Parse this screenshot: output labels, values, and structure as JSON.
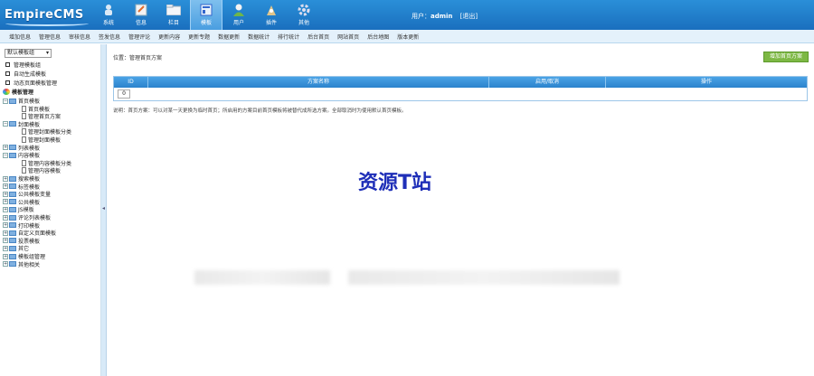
{
  "app": {
    "logo": "EmpireCMS"
  },
  "topnav": [
    {
      "label": "系统",
      "icon": "system-icon"
    },
    {
      "label": "信息",
      "icon": "info-icon"
    },
    {
      "label": "栏目",
      "icon": "column-icon"
    },
    {
      "label": "模板",
      "icon": "template-icon"
    },
    {
      "label": "用户",
      "icon": "user-icon"
    },
    {
      "label": "插件",
      "icon": "plugin-icon"
    },
    {
      "label": "其他",
      "icon": "other-icon"
    }
  ],
  "user": {
    "prefix": "用户：",
    "name": "admin",
    "logout": "[退出]"
  },
  "menubar": [
    "增加信息",
    "管理信息",
    "审核信息",
    "签发信息",
    "管理评论",
    "更新内容",
    "更新专题",
    "数据更新",
    "数据统计",
    "排行统计",
    "后台首页",
    "网站首页",
    "后台地图",
    "版本更新"
  ],
  "sidebar": {
    "select": "默认模板组",
    "links": [
      "管理模板组",
      "自动生成模板",
      "动态页面模板管理"
    ],
    "tree_root": "模板管理",
    "nodes": [
      {
        "label": "首页模板",
        "expanded": true,
        "children": [
          "首页模板",
          "管理首页方案"
        ]
      },
      {
        "label": "封面模板",
        "expanded": true,
        "children": [
          "管理封面模板分类",
          "管理封面模板"
        ]
      },
      {
        "label": "列表模板",
        "expanded": false,
        "children": []
      },
      {
        "label": "内容模板",
        "expanded": true,
        "children": [
          "管理内容模板分类",
          "管理内容模板"
        ]
      },
      {
        "label": "搜索模板",
        "expanded": false,
        "children": []
      },
      {
        "label": "标签模板",
        "expanded": false,
        "children": []
      },
      {
        "label": "公共模板变量",
        "expanded": false,
        "children": []
      },
      {
        "label": "公共模板",
        "expanded": false,
        "children": []
      },
      {
        "label": "JS模板",
        "expanded": false,
        "children": []
      },
      {
        "label": "评论列表模板",
        "expanded": false,
        "children": []
      },
      {
        "label": "打印模板",
        "expanded": false,
        "children": []
      },
      {
        "label": "自定义页面模板",
        "expanded": false,
        "children": []
      },
      {
        "label": "投票模板",
        "expanded": false,
        "children": []
      },
      {
        "label": "其它",
        "expanded": false,
        "children": []
      },
      {
        "label": "模板组管理",
        "expanded": false,
        "children": []
      },
      {
        "label": "其他相关",
        "expanded": false,
        "children": []
      }
    ]
  },
  "main": {
    "breadcrumb": "位置：管理首页方案",
    "add_button": "增加首页方案",
    "columns": [
      "ID",
      "方案名称",
      "启用/取消",
      "操作"
    ],
    "rows": [
      {
        "id": "0"
      }
    ],
    "note": "说明：首页方案：可以对某一天更换为临时首页；所启用的方案目前首页模板将被替代成所选方案。全部取消时为使用默认首页模板。"
  },
  "watermark": "资源T站",
  "colors": {
    "accent": "#1a6fbe",
    "button": "#7db844",
    "watermark": "#1f2fb8"
  }
}
